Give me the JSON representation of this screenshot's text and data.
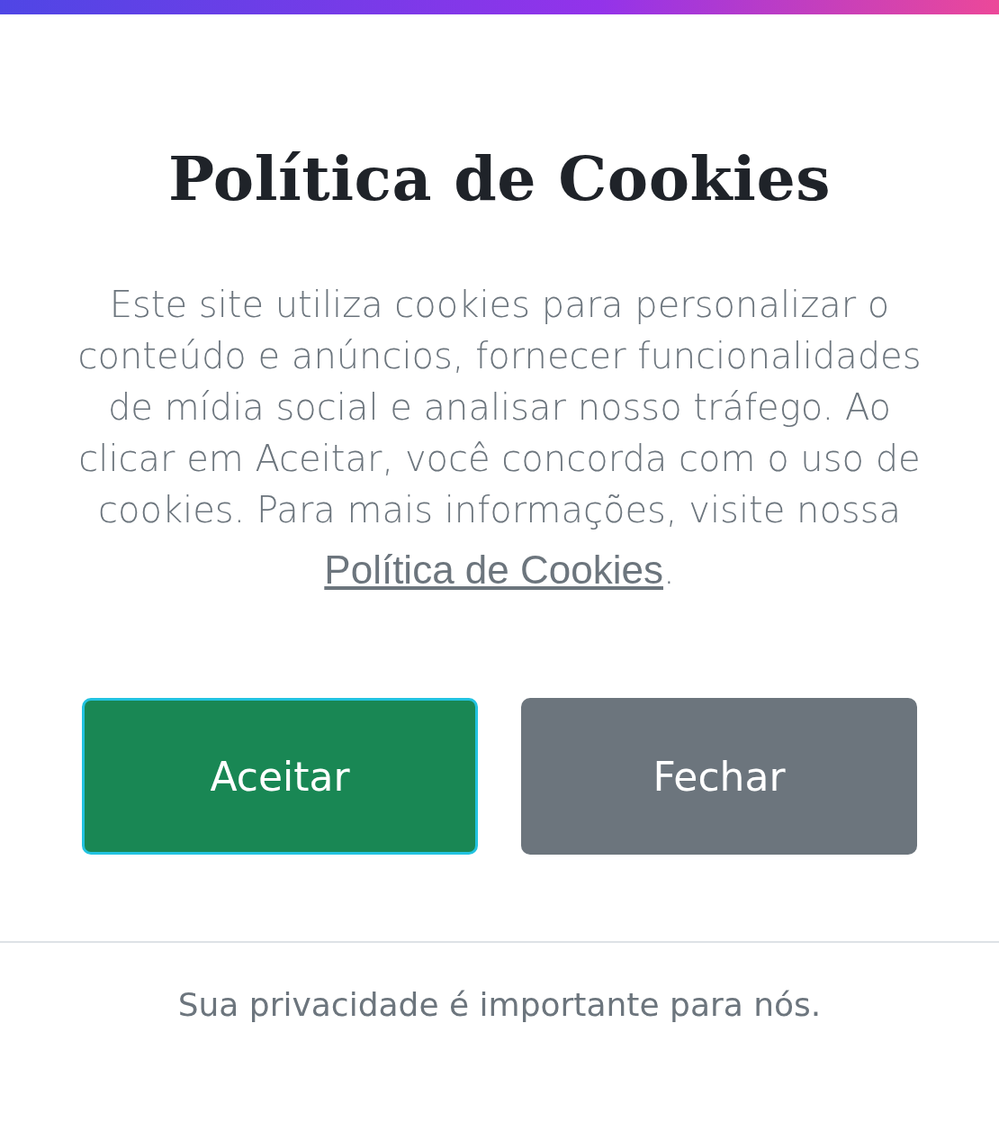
{
  "title": "Política de Cookies",
  "message": {
    "text": "Este site utiliza cookies para personalizar o conteúdo e anúncios, fornecer funcionalidades de mídia social e analisar nosso tráfego. Ao clicar em Aceitar, você concorda com o uso de cookies. Para mais informações, visite nossa",
    "link": "Política de Cookies",
    "end": "."
  },
  "buttons": [
    {
      "label": "Aceitar",
      "kind": "primary",
      "focused": true
    },
    {
      "label": "Fechar",
      "kind": "secondary",
      "focused": false
    }
  ],
  "footer": "Sua privacidade é importante para nós."
}
